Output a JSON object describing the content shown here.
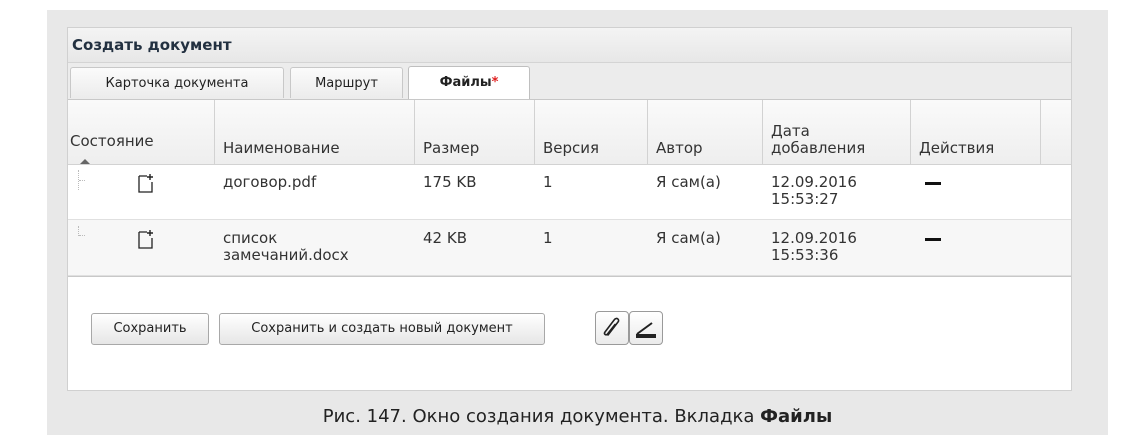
{
  "window": {
    "title": "Создать документ"
  },
  "tabs": [
    {
      "label": "Карточка документа",
      "active": false
    },
    {
      "label": "Маршрут",
      "active": false
    },
    {
      "label": "Файлы",
      "required_mark": "*",
      "active": true
    }
  ],
  "grid": {
    "columns": [
      "Состояние",
      "Наименование",
      "Размер",
      "Версия",
      "Автор",
      "Дата добавления",
      "Действия"
    ],
    "rows": [
      {
        "name": "договор.pdf",
        "size": "175 KB",
        "version": "1",
        "author": "Я сам(а)",
        "date": "12.09.2016",
        "time": "15:53:27",
        "status_icon": "new-file-icon",
        "action_icon": "dash-icon"
      },
      {
        "name": "список замечаний.docx",
        "size": "42 KB",
        "version": "1",
        "author": "Я сам(а)",
        "date": "12.09.2016",
        "time": "15:53:36",
        "status_icon": "new-file-icon",
        "action_icon": "dash-icon"
      }
    ]
  },
  "toolbar": {
    "save_label": "Сохранить",
    "save_new_label": "Сохранить и создать новый документ",
    "attach_icon": "paperclip-icon",
    "scan_icon": "scanner-icon"
  },
  "caption": {
    "prefix": "Рис. 147. Окно создания документа. Вкладка ",
    "bold": "Файлы"
  }
}
